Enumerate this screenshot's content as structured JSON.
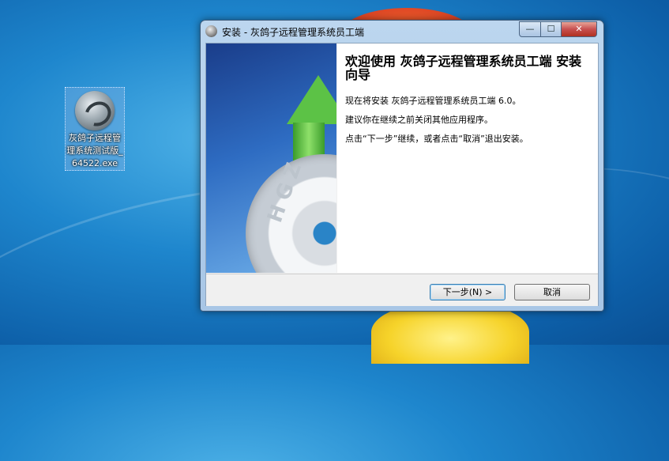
{
  "desktop": {
    "icon_label": "灰鸽子远程管理系统测试版_64522.exe"
  },
  "window": {
    "title": "安装 - 灰鸽子远程管理系统员工端",
    "controls": {
      "minimize": "—",
      "maximize": "☐",
      "close": "✕"
    },
    "banner_text": "HGZ",
    "heading": "欢迎使用 灰鸽子远程管理系统员工端 安装向导",
    "paragraphs": [
      "现在将安装 灰鸽子远程管理系统员工端 6.0。",
      "建议你在继续之前关闭其他应用程序。",
      "点击“下一步”继续，或者点击“取消”退出安装。"
    ],
    "buttons": {
      "next": "下一步(N) >",
      "cancel": "取消"
    }
  },
  "colors": {
    "title_bar": "#bcd6ef",
    "close_button": "#c75050",
    "desktop": "#1e86cd"
  }
}
